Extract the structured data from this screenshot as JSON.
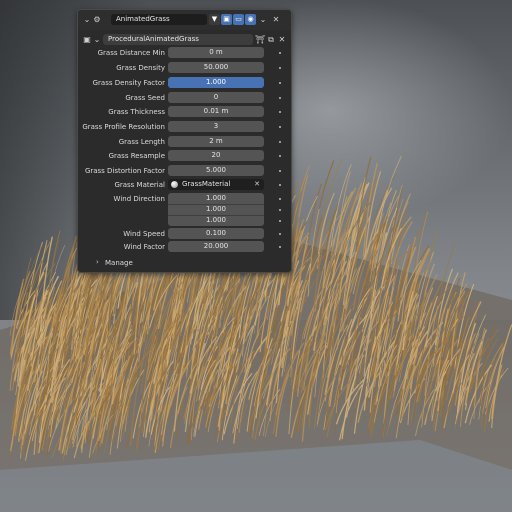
{
  "header": {
    "object_name": "AnimatedGrass",
    "modifier_name": "ProceduralAnimatedGrass"
  },
  "icons": {
    "expand": "chevron-down-icon",
    "modifier": "geometry-nodes-icon",
    "filter": "funnel-icon",
    "editmode": "edit-mode-icon",
    "realtime": "monitor-icon",
    "render": "camera-icon",
    "dropdown": "chevron-down-icon",
    "close": "close-icon",
    "shield": "shield-icon",
    "copy": "duplicate-icon",
    "material": "material-sphere-icon",
    "clear": "close-icon"
  },
  "properties": [
    {
      "label": "Grass Distance Min",
      "value": "0 m"
    },
    {
      "label": "Grass Density",
      "value": "50.000"
    },
    {
      "label": "Grass Density Factor",
      "value": "1.000",
      "active": true
    },
    {
      "label": "Grass Seed",
      "value": "0"
    },
    {
      "label": "Grass Thickness",
      "value": "0.01 m"
    },
    {
      "label": "Grass Profile Resolution",
      "value": "3"
    },
    {
      "label": "Grass Length",
      "value": "2 m"
    },
    {
      "label": "Grass Resample",
      "value": "20"
    },
    {
      "label": "Grass Distortion Factor",
      "value": "5.000"
    }
  ],
  "material": {
    "label": "Grass Material",
    "value": "GrassMaterial"
  },
  "wind_direction": {
    "label": "Wind Direction",
    "values": [
      "1.000",
      "1.000",
      "1.000"
    ]
  },
  "wind_speed": {
    "label": "Wind Speed",
    "value": "0.100"
  },
  "wind_factor": {
    "label": "Wind Factor",
    "value": "20.000"
  },
  "manage": {
    "label": "Manage"
  },
  "colors": {
    "accent": "#4772b3",
    "panel": "#2b2b2b",
    "field": "#545454",
    "grass": "#b08a4e"
  }
}
